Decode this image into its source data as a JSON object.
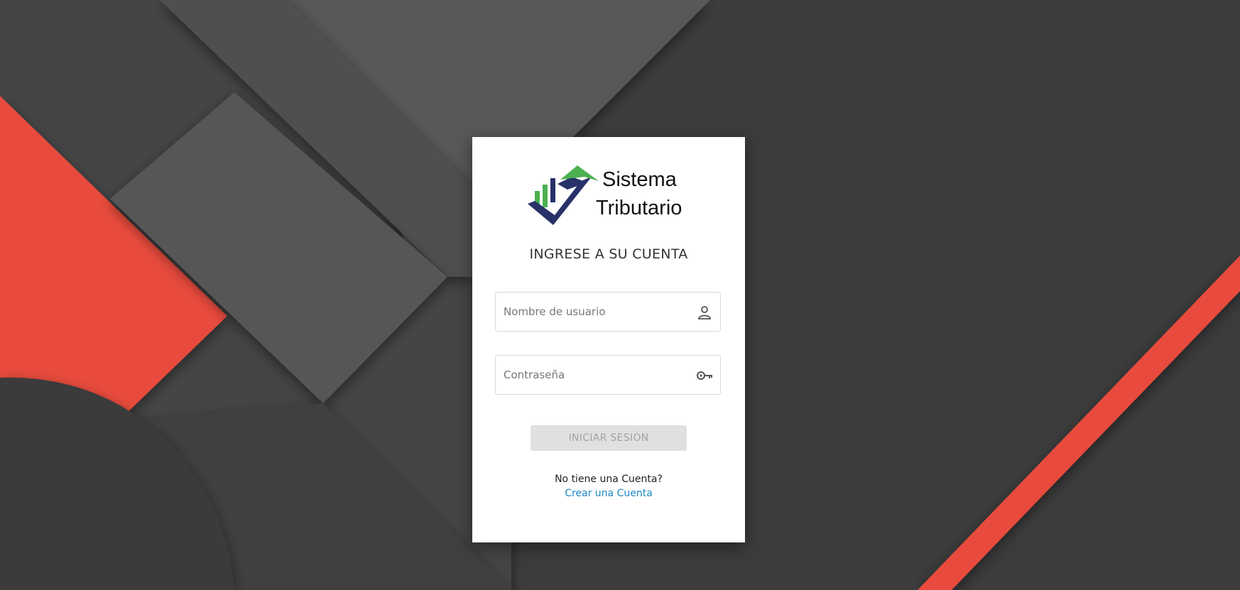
{
  "app": {
    "logo_line1": "Sistema",
    "logo_line2": "Tributario"
  },
  "login": {
    "heading": "INGRESE A SU CUENTA",
    "username": {
      "placeholder": "Nombre de usuario",
      "value": "",
      "icon": "user-icon"
    },
    "password": {
      "placeholder": "Contraseña",
      "value": "",
      "icon": "key-icon"
    },
    "submit_label": "INICIAR SESIÓN",
    "no_account_text": "No tiene una Cuenta?",
    "create_account_label": "Crear una Cuenta"
  },
  "colors": {
    "background_dark": "#3c3c3c",
    "background_mid": "#4a4a4a",
    "background_light": "#575757",
    "accent_red": "#e84c3d",
    "link_blue": "#1e88c8",
    "logo_green": "#4caf50",
    "logo_navy": "#283168",
    "button_disabled": "#e0e0e0"
  }
}
